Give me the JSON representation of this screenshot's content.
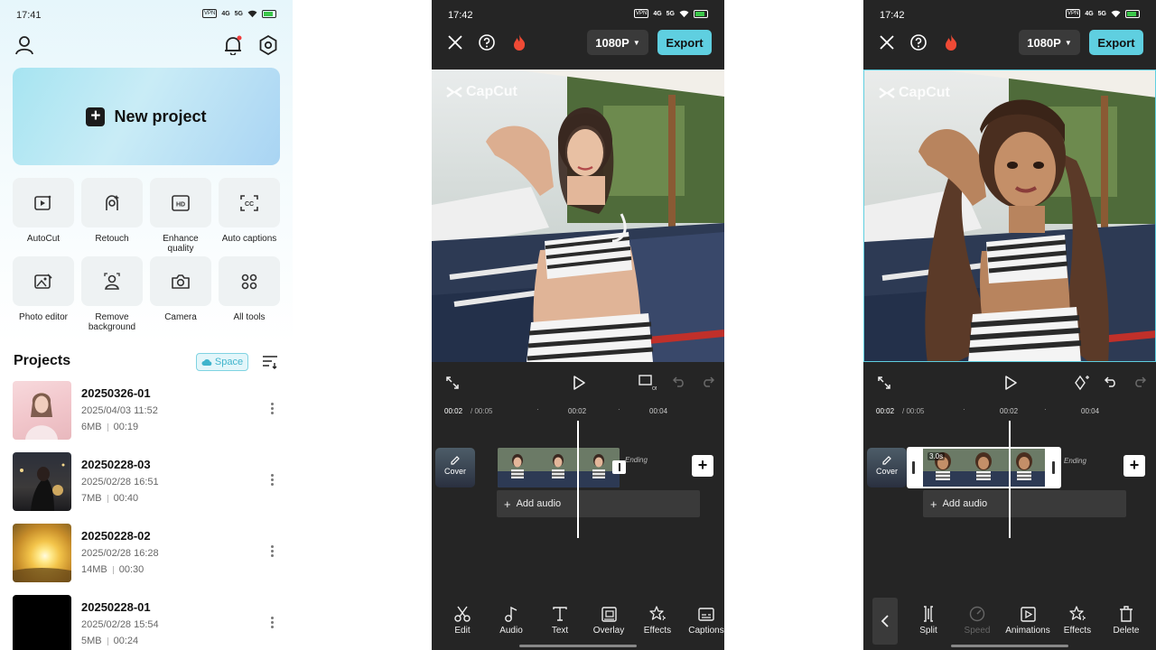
{
  "colors": {
    "accent": "#5fcfe0",
    "dark_bg": "#252525",
    "selected_border": "#ffffff"
  },
  "home": {
    "status": {
      "time": "17:41",
      "vpn": "VPN",
      "net": "4G",
      "net2": "5G"
    },
    "new_project": "New project",
    "tools": [
      {
        "label": "AutoCut",
        "icon": "autocut-icon"
      },
      {
        "label": "Retouch",
        "icon": "retouch-icon"
      },
      {
        "label": "Enhance\nquality",
        "icon": "hd-icon"
      },
      {
        "label": "Auto captions",
        "icon": "captions-icon"
      },
      {
        "label": "Photo editor",
        "icon": "photo-editor-icon"
      },
      {
        "label": "Remove\nbackground",
        "icon": "remove-bg-icon"
      },
      {
        "label": "Camera",
        "icon": "camera-icon"
      },
      {
        "label": "All tools",
        "icon": "all-tools-icon"
      }
    ],
    "projects_title": "Projects",
    "space_label": "Space",
    "projects": [
      {
        "name": "20250326-01",
        "date": "2025/04/03 11:52",
        "size": "6MB",
        "duration": "00:19"
      },
      {
        "name": "20250228-03",
        "date": "2025/02/28 16:51",
        "size": "7MB",
        "duration": "00:40"
      },
      {
        "name": "20250228-02",
        "date": "2025/02/28 16:28",
        "size": "14MB",
        "duration": "00:30"
      },
      {
        "name": "20250228-01",
        "date": "2025/02/28 15:54",
        "size": "5MB",
        "duration": "00:24"
      }
    ]
  },
  "editor1": {
    "status": {
      "time": "17:42"
    },
    "resolution": "1080P",
    "export": "Export",
    "watermark": "CapCut",
    "timecode": "00:02",
    "duration": "/ 00:05",
    "ruler": [
      "00:02",
      "00:04"
    ],
    "cover": "Cover",
    "ending": "Ending",
    "add_audio": "Add audio",
    "toolbar": [
      "Edit",
      "Audio",
      "Text",
      "Overlay",
      "Effects",
      "Captions"
    ]
  },
  "editor2": {
    "status": {
      "time": "17:42"
    },
    "resolution": "1080P",
    "export": "Export",
    "watermark": "CapCut",
    "timecode": "00:02",
    "duration": "/ 00:05",
    "ruler": [
      "00:02",
      "00:04"
    ],
    "cover": "Cover",
    "clip_duration": "3.0s",
    "ending": "Ending",
    "add_audio": "Add audio",
    "toolbar": [
      "Split",
      "Speed",
      "Animations",
      "Effects",
      "Delete"
    ]
  }
}
